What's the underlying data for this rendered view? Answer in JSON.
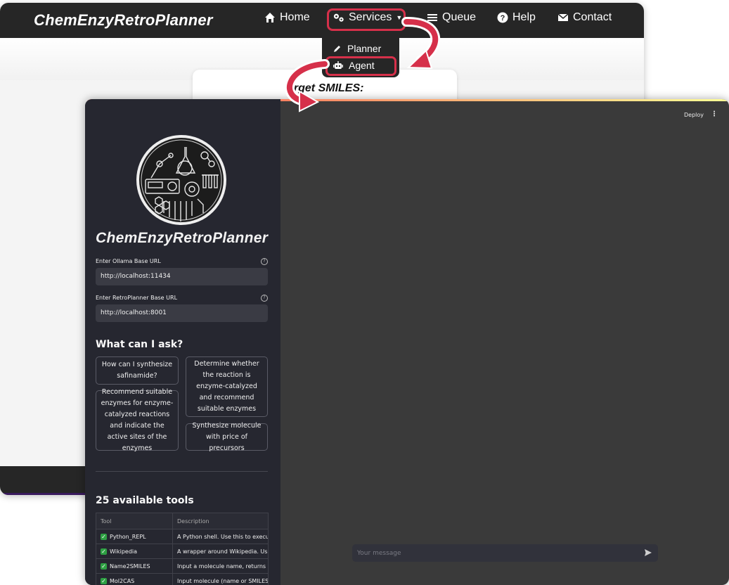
{
  "website": {
    "brand": "ChemEnzyRetroPlanner",
    "nav": {
      "home": "Home",
      "services": "Services",
      "queue": "Queue",
      "help": "Help",
      "contact": "Contact"
    },
    "services_menu": {
      "planner": "Planner",
      "agent": "Agent"
    },
    "card_title": "arget SMILES:"
  },
  "app": {
    "sidebar": {
      "title": "ChemEnzyRetroPlanner",
      "ollama_label": "Enter Ollama Base URL",
      "ollama_value": "http://localhost:11434",
      "retro_label": "Enter RetroPlanner Base URL",
      "retro_value": "http://localhost:8001",
      "ask_heading": "What can I ask?",
      "questions": [
        "How can I synthesize safinamide?",
        "Determine whether the reaction is enzyme-catalyzed and recommend suitable enzymes",
        "Recommend suitable enzymes for enzyme-catalyzed reactions and indicate the active sites of the enzymes",
        "Synthesize molecule with price of precursors"
      ],
      "tools_heading": "25 available tools",
      "tools_table": {
        "headers": [
          "Tool",
          "Description"
        ],
        "rows": [
          [
            "Python_REPL",
            "A Python shell. Use this to execute p"
          ],
          [
            "Wikipedia",
            "A wrapper around Wikipedia. Useful"
          ],
          [
            "Name2SMILES",
            "Input a molecule name, returns SMIL"
          ],
          [
            "Mol2CAS",
            "Input molecule (name or SMILES), re"
          ]
        ]
      }
    },
    "toolbar": {
      "deploy": "Deploy",
      "menu": "⋮"
    },
    "chat": {
      "placeholder": "Your message"
    }
  },
  "colors": {
    "highlight": "#d6304a",
    "navbar": "#262626",
    "sidebar": "#262730",
    "main": "#3a3a3a"
  }
}
